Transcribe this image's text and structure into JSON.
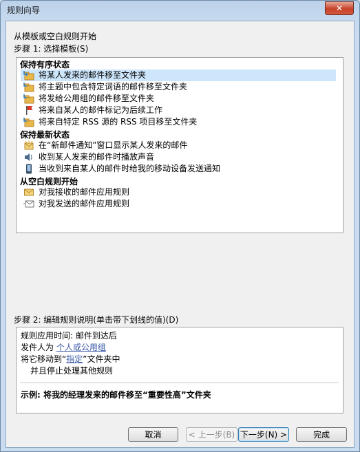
{
  "window": {
    "title": "规则向导",
    "close_glyph": "✕"
  },
  "heading": "从模板或空白规则开始",
  "step1": "步骤 1: 选择模板(S)",
  "groups": [
    {
      "title": "保持有序状态",
      "items": [
        {
          "label": "将某人发来的邮件移至文件夹",
          "icon": "move-folder-icon",
          "selected": true
        },
        {
          "label": "将主题中包含特定词语的邮件移至文件夹",
          "icon": "move-folder-icon"
        },
        {
          "label": "将发给公用组的邮件移至文件夹",
          "icon": "move-folder-icon"
        },
        {
          "label": "将来自某人的邮件标记为后续工作",
          "icon": "flag-icon"
        },
        {
          "label": "将来自特定 RSS 源的 RSS 项目移至文件夹",
          "icon": "move-folder-icon"
        }
      ]
    },
    {
      "title": "保持最新状态",
      "items": [
        {
          "label": "在“新邮件通知”窗口显示某人发来的邮件",
          "icon": "new-mail-alert-icon"
        },
        {
          "label": "收到某人发来的邮件时播放声音",
          "icon": "speaker-icon"
        },
        {
          "label": "当收到来自某人的邮件时给我的移动设备发送通知",
          "icon": "mobile-device-icon"
        }
      ]
    },
    {
      "title": "从空白规则开始",
      "items": [
        {
          "label": "对我接收的邮件应用规则",
          "icon": "envelope-icon"
        },
        {
          "label": "对我发送的邮件应用规则",
          "icon": "sent-mail-icon"
        }
      ]
    }
  ],
  "step2": "步骤 2: 编辑规则说明(单击带下划线的值)(D)",
  "description": {
    "line1": "规则应用时间: 邮件到达后",
    "line2_prefix": "发件人为 ",
    "line2_link": "个人或公用组",
    "line3_prefix": "将它移动到“",
    "line3_link": "指定",
    "line3_suffix": "”文件夹中",
    "line4": "并且停止处理其他规则",
    "example": "示例: 将我的经理发来的邮件移至“重要性高”文件夹"
  },
  "buttons": {
    "cancel": "取消",
    "back": "< 上一步(B)",
    "next": "下一步(N) >",
    "finish": "完成"
  },
  "colors": {
    "selection": "#cde6fb",
    "link": "#3a59a8",
    "folder": "#e8b94a",
    "flag": "#d93a2b"
  }
}
